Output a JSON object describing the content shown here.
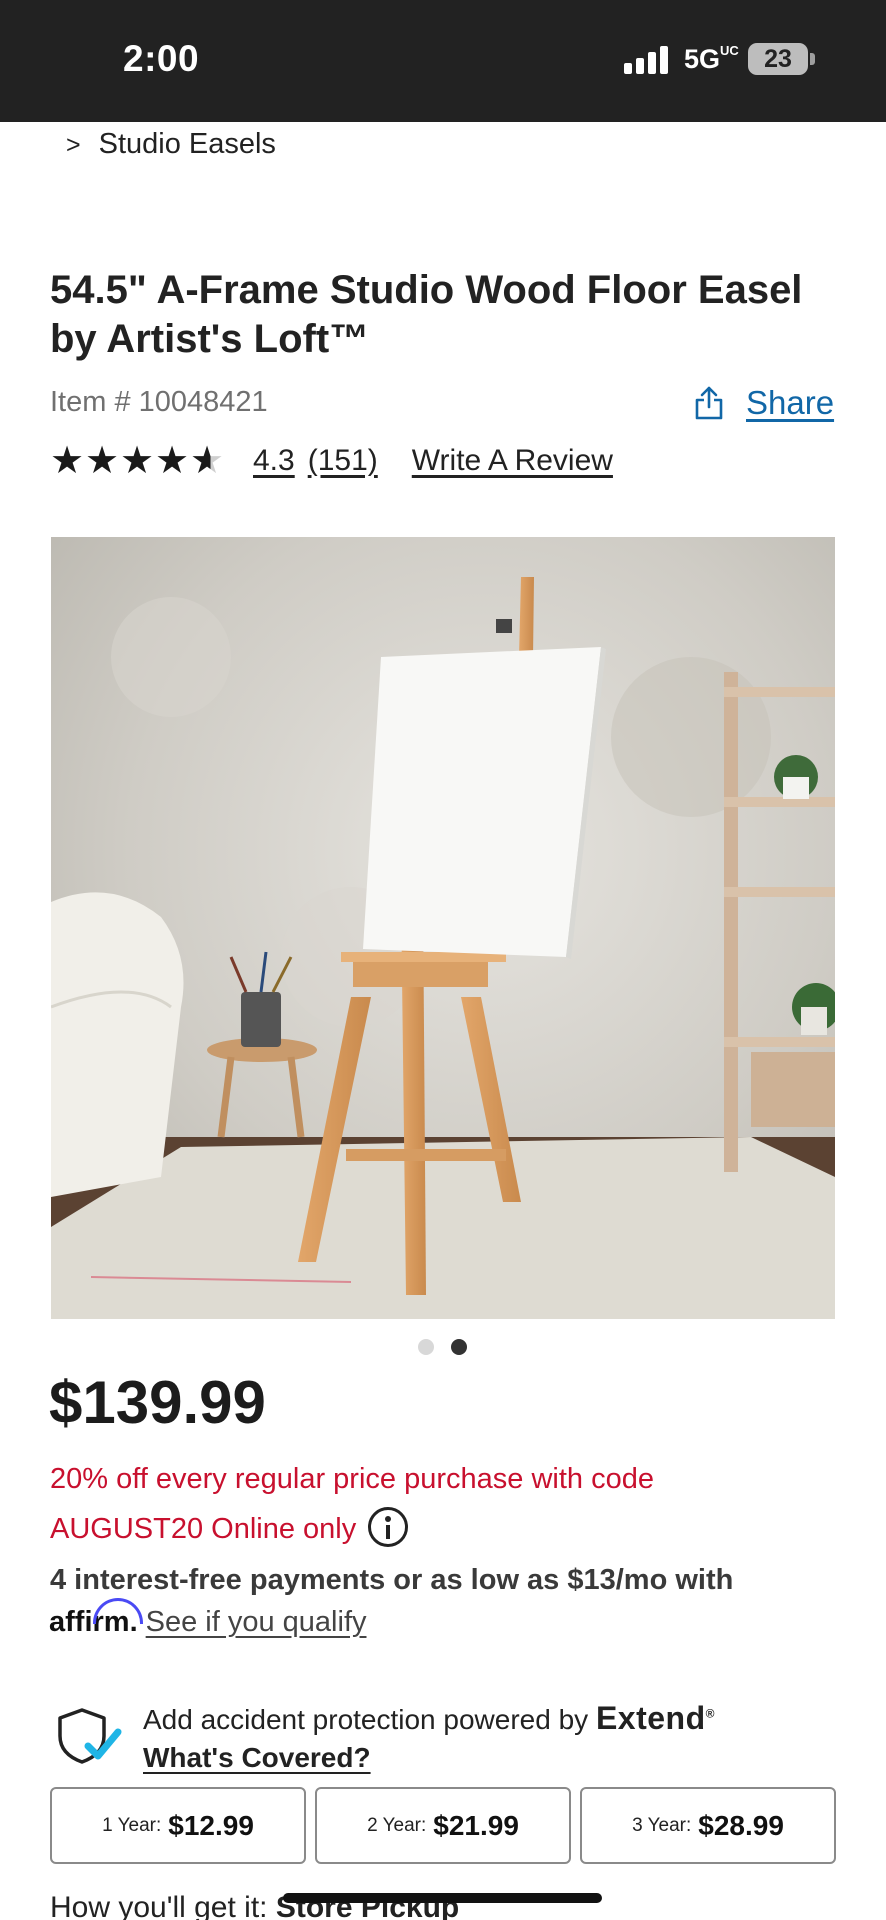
{
  "status_bar": {
    "time": "2:00",
    "network": "5G",
    "network_sup": "UC",
    "battery": "23"
  },
  "breadcrumb": {
    "chevron": ">",
    "label": "Studio Easels"
  },
  "product": {
    "title": "54.5\" A-Frame Studio Wood Floor Easel by Artist's Loft™",
    "item_number": "Item # 10048421",
    "share_label": "Share",
    "rating": 4.3,
    "rating_text": "4.3",
    "review_count": "(151)",
    "write_review_label": "Write A Review",
    "image_count": 2,
    "active_image": 2,
    "price": "$139.99",
    "promo_line1": "20% off every regular price purchase with code",
    "promo_line2": "AUGUST20 Online only",
    "affirm_text": "4 interest-free payments or as low as $13/mo with",
    "affirm_logo": "affirm",
    "affirm_link": "See if you qualify"
  },
  "protection": {
    "text": "Add accident protection powered by",
    "brand": "Extend",
    "whats_covered": "What's Covered?",
    "plans": [
      {
        "term": "1 Year:",
        "price": "$12.99"
      },
      {
        "term": "2 Year:",
        "price": "$21.99"
      },
      {
        "term": "3 Year:",
        "price": "$28.99"
      }
    ]
  },
  "fulfillment": {
    "label": "How you'll get it:",
    "method": "Store Pickup"
  },
  "colors": {
    "status_bar": "#222222",
    "share_link": "#1167a7",
    "promo": "#c8102e",
    "affirm_arc": "#4a4af4",
    "check": "#1fb5e6"
  }
}
